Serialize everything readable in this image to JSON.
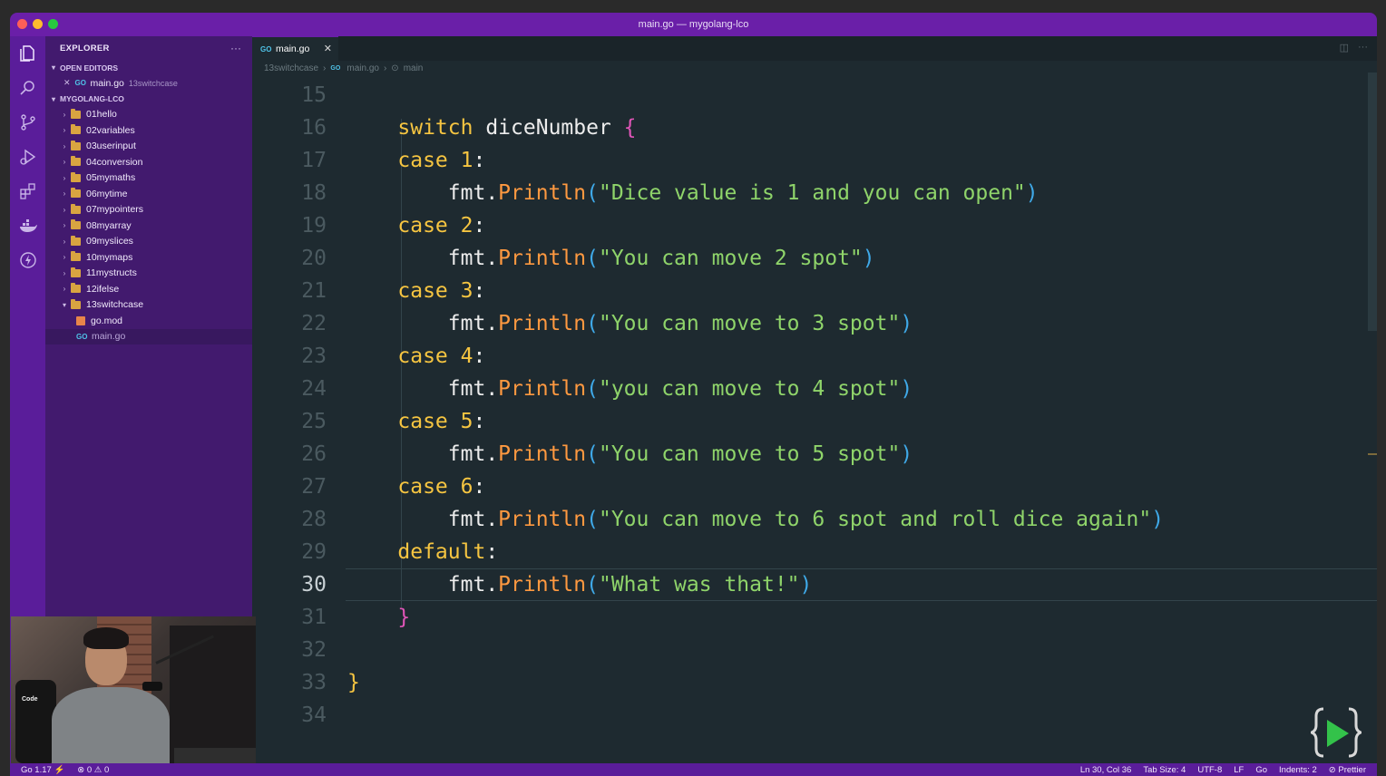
{
  "window": {
    "title": "main.go — mygolang-lco"
  },
  "activity_bar": {
    "items": [
      "files-icon",
      "search-icon",
      "source-control-icon",
      "run-debug-icon",
      "extensions-icon",
      "docker-icon",
      "lightning-icon"
    ]
  },
  "explorer": {
    "header": "EXPLORER",
    "more": "···",
    "open_editors": {
      "title": "OPEN EDITORS",
      "files": [
        {
          "name": "main.go",
          "folder": "13switchcase"
        }
      ]
    },
    "workspace": {
      "title": "MYGOLANG-LCO",
      "folders": [
        "01hello",
        "02variables",
        "03userinput",
        "04conversion",
        "05mymaths",
        "06mytime",
        "07mypointers",
        "08myarray",
        "09myslices",
        "10mymaps",
        "11mystructs",
        "12ifelse"
      ],
      "open_folder": "13switchcase",
      "open_folder_files": [
        {
          "name": "go.mod",
          "type": "mod"
        },
        {
          "name": "main.go",
          "type": "go"
        }
      ]
    }
  },
  "tab": {
    "label": "main.go",
    "close": "✕"
  },
  "breadcrumb": {
    "folder": "13switchcase",
    "file": "main.go",
    "symbol": "main"
  },
  "code": {
    "current_line": 30,
    "lines": [
      {
        "n": "15",
        "tokens": []
      },
      {
        "n": "16",
        "indent": "    ",
        "tokens": [
          {
            "t": "switch",
            "c": "kw"
          },
          {
            "t": " diceNumber ",
            "c": "ident"
          },
          {
            "t": "{",
            "c": "br1"
          }
        ]
      },
      {
        "n": "17",
        "indent": "    ",
        "tokens": [
          {
            "t": "case",
            "c": "kw"
          },
          {
            "t": " ",
            "c": "ident"
          },
          {
            "t": "1",
            "c": "num"
          },
          {
            "t": ":",
            "c": "ident"
          }
        ]
      },
      {
        "n": "18",
        "indent": "        ",
        "tokens": [
          {
            "t": "fmt.",
            "c": "ident"
          },
          {
            "t": "Println",
            "c": "fn"
          },
          {
            "t": "(",
            "c": "br2"
          },
          {
            "t": "\"Dice value is 1 and you can open\"",
            "c": "str"
          },
          {
            "t": ")",
            "c": "br2"
          }
        ]
      },
      {
        "n": "19",
        "indent": "    ",
        "tokens": [
          {
            "t": "case",
            "c": "kw"
          },
          {
            "t": " ",
            "c": "ident"
          },
          {
            "t": "2",
            "c": "num"
          },
          {
            "t": ":",
            "c": "ident"
          }
        ]
      },
      {
        "n": "20",
        "indent": "        ",
        "tokens": [
          {
            "t": "fmt.",
            "c": "ident"
          },
          {
            "t": "Println",
            "c": "fn"
          },
          {
            "t": "(",
            "c": "br2"
          },
          {
            "t": "\"You can move 2 spot\"",
            "c": "str"
          },
          {
            "t": ")",
            "c": "br2"
          }
        ]
      },
      {
        "n": "21",
        "indent": "    ",
        "tokens": [
          {
            "t": "case",
            "c": "kw"
          },
          {
            "t": " ",
            "c": "ident"
          },
          {
            "t": "3",
            "c": "num"
          },
          {
            "t": ":",
            "c": "ident"
          }
        ]
      },
      {
        "n": "22",
        "indent": "        ",
        "tokens": [
          {
            "t": "fmt.",
            "c": "ident"
          },
          {
            "t": "Println",
            "c": "fn"
          },
          {
            "t": "(",
            "c": "br2"
          },
          {
            "t": "\"You can move to 3 spot\"",
            "c": "str"
          },
          {
            "t": ")",
            "c": "br2"
          }
        ]
      },
      {
        "n": "23",
        "indent": "    ",
        "tokens": [
          {
            "t": "case",
            "c": "kw"
          },
          {
            "t": " ",
            "c": "ident"
          },
          {
            "t": "4",
            "c": "num"
          },
          {
            "t": ":",
            "c": "ident"
          }
        ]
      },
      {
        "n": "24",
        "indent": "        ",
        "tokens": [
          {
            "t": "fmt.",
            "c": "ident"
          },
          {
            "t": "Println",
            "c": "fn"
          },
          {
            "t": "(",
            "c": "br2"
          },
          {
            "t": "\"you can move to 4 spot\"",
            "c": "str"
          },
          {
            "t": ")",
            "c": "br2"
          }
        ]
      },
      {
        "n": "25",
        "indent": "    ",
        "tokens": [
          {
            "t": "case",
            "c": "kw"
          },
          {
            "t": " ",
            "c": "ident"
          },
          {
            "t": "5",
            "c": "num"
          },
          {
            "t": ":",
            "c": "ident"
          }
        ]
      },
      {
        "n": "26",
        "indent": "        ",
        "tokens": [
          {
            "t": "fmt.",
            "c": "ident"
          },
          {
            "t": "Println",
            "c": "fn"
          },
          {
            "t": "(",
            "c": "br2"
          },
          {
            "t": "\"You can move to 5 spot\"",
            "c": "str"
          },
          {
            "t": ")",
            "c": "br2"
          }
        ]
      },
      {
        "n": "27",
        "indent": "    ",
        "tokens": [
          {
            "t": "case",
            "c": "kw"
          },
          {
            "t": " ",
            "c": "ident"
          },
          {
            "t": "6",
            "c": "num"
          },
          {
            "t": ":",
            "c": "ident"
          }
        ]
      },
      {
        "n": "28",
        "indent": "        ",
        "tokens": [
          {
            "t": "fmt.",
            "c": "ident"
          },
          {
            "t": "Println",
            "c": "fn"
          },
          {
            "t": "(",
            "c": "br2"
          },
          {
            "t": "\"You can move to 6 spot and roll dice again\"",
            "c": "str"
          },
          {
            "t": ")",
            "c": "br2"
          }
        ]
      },
      {
        "n": "29",
        "indent": "    ",
        "tokens": [
          {
            "t": "default",
            "c": "kw"
          },
          {
            "t": ":",
            "c": "ident"
          }
        ]
      },
      {
        "n": "30",
        "indent": "        ",
        "tokens": [
          {
            "t": "fmt.",
            "c": "ident"
          },
          {
            "t": "Println",
            "c": "fn"
          },
          {
            "t": "(",
            "c": "br2"
          },
          {
            "t": "\"What was that!\"",
            "c": "str"
          },
          {
            "t": ")",
            "c": "br2"
          }
        ]
      },
      {
        "n": "31",
        "indent": "    ",
        "tokens": [
          {
            "t": "}",
            "c": "br1"
          }
        ]
      },
      {
        "n": "32",
        "tokens": []
      },
      {
        "n": "33",
        "tokens": [
          {
            "t": "}",
            "c": "br3"
          }
        ]
      },
      {
        "n": "34",
        "tokens": []
      }
    ]
  },
  "status_bar": {
    "left": [
      "Go 1.17 ⚡",
      "⊗ 0 ⚠ 0"
    ],
    "right": [
      "Ln 30, Col 36",
      "Tab Size: 4",
      "UTF-8",
      "LF",
      "Go",
      "Indents: 2",
      "⊘ Prettier"
    ]
  },
  "webcam": {
    "chair_logo": "Code"
  },
  "colors": {
    "titlebar": "#6a1fa8",
    "activity_bar": "#5a1d9a",
    "sidebar": "#421a6e",
    "editor_bg": "#1e2a30",
    "keyword": "#f6c541",
    "string": "#8fd46a",
    "function": "#ff9940"
  }
}
